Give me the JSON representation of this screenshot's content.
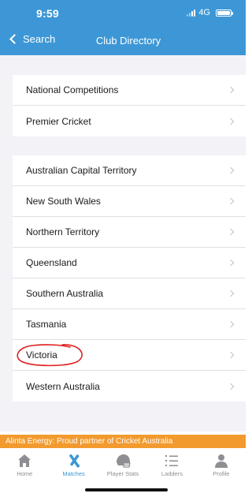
{
  "status_bar": {
    "time": "9:59",
    "network": "4G"
  },
  "nav": {
    "back_label": "Search",
    "title": "Club Directory"
  },
  "sections": [
    {
      "items": [
        {
          "label": "National Competitions"
        },
        {
          "label": "Premier Cricket"
        }
      ]
    },
    {
      "items": [
        {
          "label": "Australian Capital Territory"
        },
        {
          "label": "New South Wales"
        },
        {
          "label": "Northern Territory"
        },
        {
          "label": "Queensland"
        },
        {
          "label": "Southern Australia"
        },
        {
          "label": "Tasmania"
        },
        {
          "label": "Victoria"
        },
        {
          "label": "Western Australia"
        }
      ]
    }
  ],
  "banner": {
    "text": "Alinta Energy: Proud partner of Cricket Australia"
  },
  "tabs": [
    {
      "label": "Home",
      "icon": "home-icon",
      "active": false
    },
    {
      "label": "Matches",
      "icon": "cricket-bats-icon",
      "active": true
    },
    {
      "label": "Player Stats",
      "icon": "helmet-icon",
      "active": false
    },
    {
      "label": "Ladders",
      "icon": "numbered-list-icon",
      "active": false
    },
    {
      "label": "Profile",
      "icon": "person-icon",
      "active": false
    }
  ],
  "colors": {
    "header": "#3d97d6",
    "banner": "#f29a2e",
    "annotation": "#e02020"
  }
}
